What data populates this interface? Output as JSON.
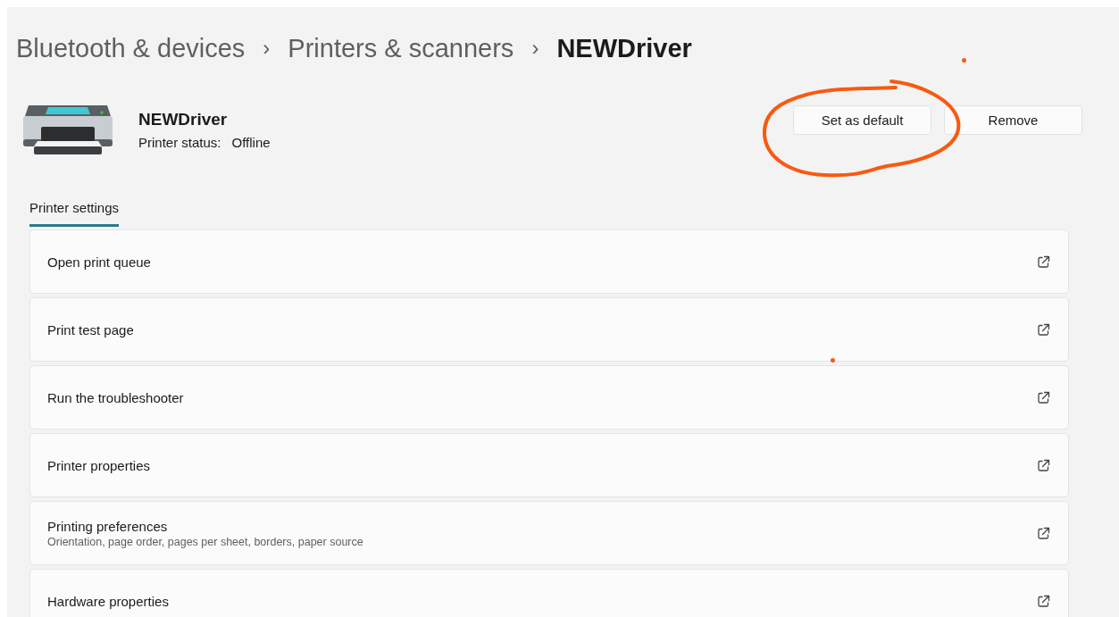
{
  "breadcrumb": [
    {
      "label": "Bluetooth & devices",
      "current": false
    },
    {
      "label": "Printers & scanners",
      "current": false
    },
    {
      "label": "NEWDriver",
      "current": true
    }
  ],
  "breadcrumb_separator": "›",
  "printer": {
    "name": "NEWDriver",
    "status_label": "Printer status:",
    "status": "Offline"
  },
  "buttons": [
    "Set as default",
    "Remove"
  ],
  "tabs": [
    {
      "label": "Printer settings",
      "selected": true
    }
  ],
  "settings": [
    {
      "title": "Open print queue"
    },
    {
      "title": "Print test page"
    },
    {
      "title": "Run the troubleshooter"
    },
    {
      "title": "Printer properties"
    },
    {
      "title": "Printing preferences",
      "description": "Orientation, page order, pages per sheet, borders, paper source"
    },
    {
      "title": "Hardware properties"
    }
  ]
}
